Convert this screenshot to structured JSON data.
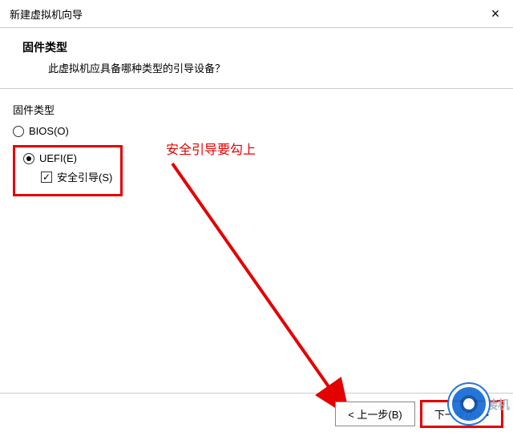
{
  "titlebar": {
    "title": "新建虚拟机向导",
    "close_icon": "×"
  },
  "header": {
    "title": "固件类型",
    "subtitle": "此虚拟机应具备哪种类型的引导设备？"
  },
  "group": {
    "label": "固件类型"
  },
  "options": {
    "bios": {
      "label": "BIOS(O)",
      "selected": false
    },
    "uefi": {
      "label": "UEFI(E)",
      "selected": true
    },
    "secure_boot": {
      "label": "安全引导(S)",
      "checked": true,
      "check_glyph": "✓"
    }
  },
  "annotation": {
    "text": "安全引导要勾上"
  },
  "footer": {
    "back": "< 上一步(B)",
    "next": "下一步(N) >"
  },
  "watermark": {
    "text": "装机"
  },
  "colors": {
    "highlight": "#e50000",
    "brand": "#1b6fd8"
  }
}
